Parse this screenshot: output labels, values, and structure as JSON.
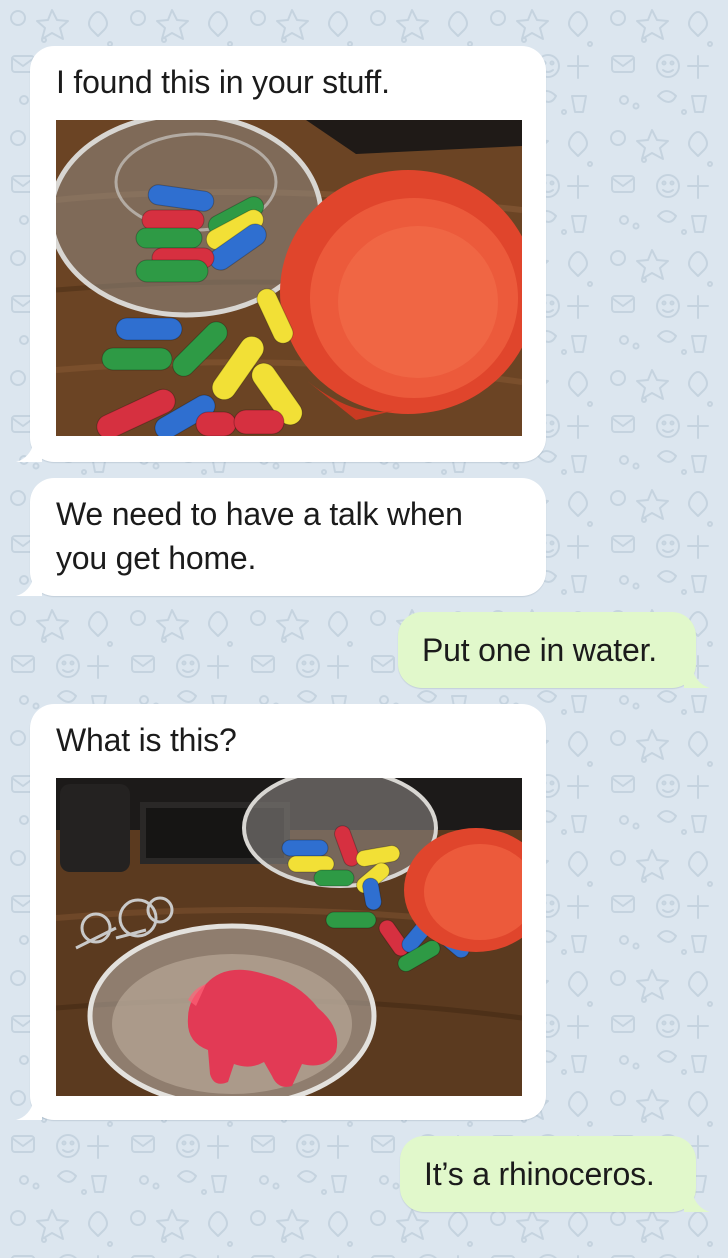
{
  "chat": {
    "theme": {
      "wallpaper_color": "#dce6ef",
      "wallpaper_doodle_color": "#c5d3df",
      "incoming_bubble_color": "#ffffff",
      "outgoing_bubble_color": "#e1f8cb"
    },
    "messages": [
      {
        "direction": "incoming",
        "text": "I found this in your stuff.",
        "attachment": "photo-capsules-in-tub-and-red-lid"
      },
      {
        "direction": "incoming",
        "text": "We need to have a talk when\nyou get home."
      },
      {
        "direction": "outgoing",
        "text": "Put one in water."
      },
      {
        "direction": "incoming",
        "text": "What is this?",
        "attachment": "photo-red-sponge-rhino-in-water"
      },
      {
        "direction": "outgoing",
        "text": "It’s a rhinoceros."
      }
    ]
  }
}
